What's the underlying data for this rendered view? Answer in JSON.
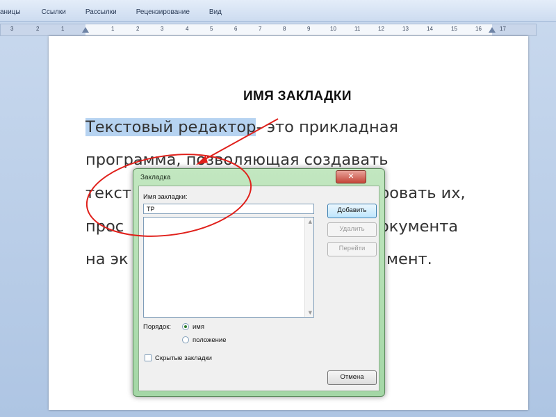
{
  "ribbon": {
    "tabs": [
      "аницы",
      "Ссылки",
      "Рассылки",
      "Рецензирование",
      "Вид"
    ]
  },
  "ruler": {
    "numbers": [
      "3",
      "2",
      "1",
      "1",
      "2",
      "3",
      "4",
      "5",
      "6",
      "7",
      "8",
      "9",
      "10",
      "11",
      "12",
      "13",
      "14",
      "15",
      "16",
      "17"
    ]
  },
  "document": {
    "heading": "ИМЯ ЗАКЛАДКИ",
    "lines": [
      {
        "highlighted": "Текстовый редактор",
        "rest": "- это прикладная"
      },
      {
        "highlighted": "",
        "rest": "программа, позволяющая создавать"
      },
      {
        "highlighted": "",
        "rest": "текст",
        "rest_right": "ровать их,"
      },
      {
        "highlighted": "",
        "rest": "прос",
        "rest_right": "окумента"
      },
      {
        "highlighted": "",
        "rest": "на эк",
        "rest_right": "мент."
      }
    ]
  },
  "dialog": {
    "title": "Закладка",
    "close_label": "✕",
    "name_label": "Имя закладки:",
    "name_value": "ТР",
    "buttons": {
      "add": "Добавить",
      "delete": "Удалить",
      "goto": "Перейти",
      "cancel": "Отмена"
    },
    "order_label": "Порядок:",
    "order_options": [
      "имя",
      "положение"
    ],
    "order_selected": "имя",
    "hidden_bookmarks_label": "Скрытые закладки",
    "hidden_bookmarks_checked": false
  },
  "annotation": {
    "color": "#e0201b"
  }
}
